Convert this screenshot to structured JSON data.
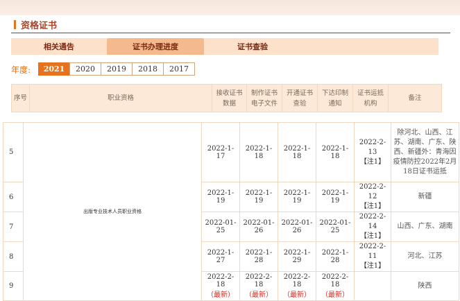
{
  "section_title": "资格证书",
  "tabs": [
    "相关通告",
    "证书办理进度",
    "证书查验"
  ],
  "year_label": "年度:",
  "years": [
    "2021",
    "2020",
    "2019",
    "2018",
    "2017"
  ],
  "selected_year": "2021",
  "table": {
    "headers": {
      "seq": "序号",
      "qual": "职业资格",
      "receive": "接收证书数据",
      "make_e": "制作证书电子文件",
      "send_check": "开通证书查验",
      "print": "下达印制通知",
      "mail": "证书运抵机构",
      "remark": "备注"
    },
    "qualification": "出版专业技术人员职业资格",
    "latest_tag": "（最新）",
    "rows": [
      {
        "seq": "5",
        "receive": "2022-1-17",
        "make_e": "2022-1-18",
        "send_check": "2022-1-18",
        "print": "2022-1-18",
        "mail": "2022-2-13",
        "mail_note": "【注1】",
        "remark": "除河北、山西、江苏、湖南、广东、陕西、新疆外：青海因疫情防控2022年2月18日证书运抵"
      },
      {
        "seq": "6",
        "receive": "2022-1-19",
        "make_e": "2022-1-19",
        "send_check": "2022-1-19",
        "print": "2022-1-19",
        "mail": "2022-2-12",
        "mail_note": "【注1】",
        "remark": "新疆"
      },
      {
        "seq": "7",
        "receive": "2022-01-25",
        "make_e": "2022-01-26",
        "send_check": "2022-01-26",
        "print": "2022-01-25",
        "mail": "2022-2-14",
        "mail_note": "【注1】",
        "remark": "山西、广东、湖南"
      },
      {
        "seq": "8",
        "receive": "2022-1-27",
        "make_e": "2022-1-28",
        "send_check": "2022-1-29",
        "print": "2022-1-28",
        "mail": "2022-2-11",
        "mail_note": "【注1】",
        "remark": "河北、江苏"
      },
      {
        "seq": "9",
        "receive": "2022-2-18",
        "make_e": "2022-2-18",
        "send_check": "2022-2-18",
        "print": "2022-2-18",
        "mail": "",
        "mail_note": "",
        "remark": "陕西"
      }
    ]
  },
  "colors": {
    "accent": "#e8711d",
    "tab_bg": "#fde1cb",
    "header_bg": "#fce9d7",
    "latest": "#d9281c"
  }
}
